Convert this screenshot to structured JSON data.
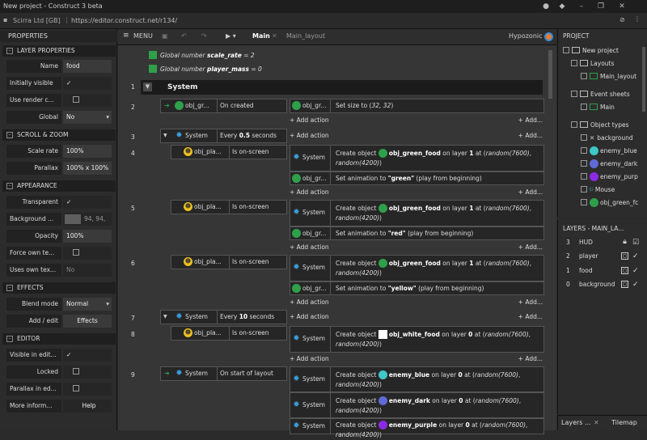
{
  "window": {
    "title": "New project - Construct 3 beta"
  },
  "address": {
    "cert": "Scirra Ltd [GB]",
    "url": "https://editor.construct.net/r134/"
  },
  "props": {
    "title": "PROPERTIES",
    "sections": [
      {
        "name": "LAYER PROPERTIES"
      },
      {
        "name": "SCROLL & ZOOM"
      },
      {
        "name": "APPEARANCE"
      },
      {
        "name": "EFFECTS"
      },
      {
        "name": "EDITOR"
      }
    ],
    "rows": {
      "name": {
        "label": "Name",
        "value": "food"
      },
      "initially_visible": {
        "label": "Initially visible",
        "value": "✓"
      },
      "use_render": {
        "label": "Use render c...",
        "value": ""
      },
      "global": {
        "label": "Global",
        "value": "No"
      },
      "scale_rate": {
        "label": "Scale rate",
        "value": "100%"
      },
      "parallax": {
        "label": "Parallax",
        "value": "100% x 100%"
      },
      "transparent": {
        "label": "Transparent",
        "value": "✓"
      },
      "background": {
        "label": "Background ...",
        "value": "94, 94,"
      },
      "opacity": {
        "label": "Opacity",
        "value": "100%"
      },
      "force_own": {
        "label": "Force own te...",
        "value": ""
      },
      "uses_own": {
        "label": "Uses own tex...",
        "value": "No"
      },
      "blend_mode": {
        "label": "Blend mode",
        "value": "Normal"
      },
      "add_edit": {
        "label": "Add / edit",
        "value": "Effects"
      },
      "visible_in_edit": {
        "label": "Visible in edit...",
        "value": "✓"
      },
      "locked": {
        "label": "Locked",
        "value": ""
      },
      "parallax_ed": {
        "label": "Parallax in ed...",
        "value": ""
      },
      "more_info": {
        "label": "More inform...",
        "value": "Help"
      }
    }
  },
  "toolbar": {
    "menu": "MENU",
    "tab_main": "Main",
    "tab_layout": "Main_layout",
    "user": "Hypozonic"
  },
  "sheet": {
    "globals": [
      {
        "prefix": "Global number ",
        "name": "scale_rate",
        "suffix": " = 2"
      },
      {
        "prefix": "Global number ",
        "name": "player_mass",
        "suffix": " = 0"
      }
    ],
    "group": {
      "num": "1",
      "name": "System"
    },
    "add_action": "+ Add action",
    "add_more": "+ Add...",
    "events": {
      "e2": {
        "num": "2",
        "obj": "obj_gr...",
        "cond": "On created",
        "act_obj": "obj_gr...",
        "act_pre": "Set size to (",
        "act_em": "32, 32",
        "act_post": ")"
      },
      "e3": {
        "num": "3",
        "obj": "System",
        "cond_pre": "Every ",
        "cond_b": "0.5",
        "cond_post": " seconds"
      },
      "e4": {
        "num": "4",
        "obj": "obj_pla...",
        "cond": "Is on-screen",
        "a1_obj": "System",
        "a1_pre": "Create object ",
        "a1_b": "obj_green_food",
        "a1_mid": " on layer ",
        "a1_layer": "1",
        "a1_at": " at (",
        "a1_em1": "random(7600)",
        "a1_comma": ", ",
        "a1_em2": "random(4200)",
        "a1_end": ")",
        "a2_obj": "obj_gr...",
        "a2_pre": "Set animation to ",
        "a2_b": "\"green\"",
        "a2_post": " (play from beginning)"
      },
      "e5": {
        "num": "5",
        "obj": "obj_pla...",
        "cond": "Is on-screen",
        "a1_obj": "System",
        "a1_pre": "Create object ",
        "a1_b": "obj_green_food",
        "a1_mid": " on layer ",
        "a1_layer": "1",
        "a1_at": " at (",
        "a1_em1": "random(7600)",
        "a1_comma": ", ",
        "a1_em2": "random(4200)",
        "a1_end": ")",
        "a2_obj": "obj_gr...",
        "a2_pre": "Set animation to ",
        "a2_b": "\"red\"",
        "a2_post": " (play from beginning)"
      },
      "e6": {
        "num": "6",
        "obj": "obj_pla...",
        "cond": "Is on-screen",
        "a1_obj": "System",
        "a1_pre": "Create object ",
        "a1_b": "obj_green_food",
        "a1_mid": " on layer ",
        "a1_layer": "1",
        "a1_at": " at (",
        "a1_em1": "random(7600)",
        "a1_comma": ", ",
        "a1_em2": "random(4200)",
        "a1_end": ")",
        "a2_obj": "obj_gr...",
        "a2_pre": "Set animation to ",
        "a2_b": "\"yellow\"",
        "a2_post": " (play from beginning)"
      },
      "e7": {
        "num": "7",
        "obj": "System",
        "cond_pre": "Every ",
        "cond_b": "10",
        "cond_post": " seconds"
      },
      "e8": {
        "num": "8",
        "obj": "obj_pla...",
        "cond": "Is on-screen",
        "a1_obj": "System",
        "a1_pre": "Create object ",
        "a1_b": "obj_white_food",
        "a1_mid": " on layer ",
        "a1_layer": "0",
        "a1_at": " at (",
        "a1_em1": "random(7600)",
        "a1_comma": ", ",
        "a1_em2": "random(4200)",
        "a1_end": ")"
      },
      "e9": {
        "num": "9",
        "obj": "System",
        "cond": "On start of layout",
        "a1_obj": "System",
        "a1_pre": "Create object ",
        "a1_b": "enemy_blue",
        "a1_mid": " on layer ",
        "a1_layer": "0",
        "a1_at": " at (",
        "a1_em1": "random(7600)",
        "a1_comma": ", ",
        "a1_em2": "random(4200)",
        "a1_end": ")",
        "a2_obj": "System",
        "a2_pre": "Create object ",
        "a2_b": "enemy_dark",
        "a2_mid": " on layer ",
        "a2_layer": "0",
        "a2_at": " at (",
        "a2_em1": "random(7600)",
        "a2_comma": ", ",
        "a2_em2": "random(4200)",
        "a2_end": ")",
        "a3_obj": "System",
        "a3_pre": "Create object ",
        "a3_b": "enemy_purple",
        "a3_mid": " on layer ",
        "a3_layer": "0",
        "a3_at": " at (",
        "a3_em1": "random(7600)",
        "a3_comma": ", ",
        "a3_em2": "random(4200)",
        "a3_end": ")"
      }
    }
  },
  "project": {
    "title": "PROJECT",
    "root": "New project",
    "layouts": "Layouts",
    "main_layout": "Main_layout",
    "event_sheets": "Event sheets",
    "main": "Main",
    "object_types": "Object types",
    "objects": [
      "background",
      "enemy_blue",
      "enemy_dark",
      "enemy_purp",
      "Mouse",
      "obj_green_fc"
    ]
  },
  "layers": {
    "title": "LAYERS - MAIN_LA...",
    "rows": [
      {
        "num": "3",
        "name": "HUD"
      },
      {
        "num": "2",
        "name": "player"
      },
      {
        "num": "1",
        "name": "food"
      },
      {
        "num": "0",
        "name": "background"
      }
    ],
    "tab1": "Layers ...",
    "tab2": "Tilemap"
  },
  "colors": {
    "green": "#2fa04a",
    "blue_food": "#3ec7c7",
    "dark": "#5f6ad6",
    "purple": "#8a2be2",
    "accent_link": "#5a9ad6"
  }
}
